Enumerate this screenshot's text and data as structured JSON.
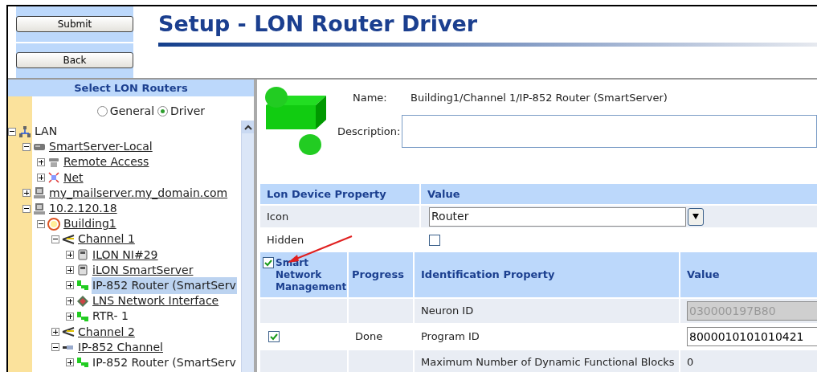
{
  "buttons": [
    {
      "label": "Submit"
    },
    {
      "label": "Back"
    }
  ],
  "page_title": "Setup - LON Router Driver",
  "sidebar": {
    "title": "Select LON Routers",
    "view_options": [
      {
        "label": "General",
        "selected": false
      },
      {
        "label": "Driver",
        "selected": true
      }
    ],
    "tree": [
      {
        "label": "LAN",
        "kind": "network",
        "link": false,
        "expanded": true,
        "selected": false,
        "children": [
          {
            "label": "SmartServer-Local",
            "kind": "server",
            "link": true,
            "expanded": true,
            "selected": false,
            "children": [
              {
                "label": "Remote Access",
                "kind": "phone",
                "link": true,
                "expanded": false,
                "selected": false
              },
              {
                "label": "Net",
                "kind": "net",
                "link": true,
                "expanded": false,
                "selected": false
              }
            ]
          },
          {
            "label": "my_mailserver.my_domain.com",
            "kind": "computer",
            "link": true,
            "expanded": false,
            "selected": false
          },
          {
            "label": "10.2.120.18",
            "kind": "computer",
            "link": true,
            "expanded": true,
            "selected": false,
            "children": [
              {
                "label": "Building1",
                "kind": "building",
                "link": true,
                "expanded": true,
                "selected": false,
                "children": [
                  {
                    "label": "Channel 1",
                    "kind": "channel",
                    "link": true,
                    "expanded": true,
                    "selected": false,
                    "children": [
                      {
                        "label": "ILON NI#29",
                        "kind": "device",
                        "link": true,
                        "expanded": false,
                        "selected": false
                      },
                      {
                        "label": "iLON SmartServer",
                        "kind": "device",
                        "link": true,
                        "expanded": false,
                        "selected": false
                      },
                      {
                        "label": "IP-852 Router (SmartServ",
                        "kind": "router",
                        "link": false,
                        "expanded": false,
                        "selected": true
                      },
                      {
                        "label": "LNS Network Interface",
                        "kind": "interface",
                        "link": true,
                        "expanded": false,
                        "selected": false
                      },
                      {
                        "label": "RTR- 1",
                        "kind": "router",
                        "link": false,
                        "expanded": false,
                        "selected": false
                      }
                    ]
                  },
                  {
                    "label": "Channel 2",
                    "kind": "channel",
                    "link": true,
                    "expanded": false,
                    "selected": false
                  },
                  {
                    "label": "IP-852 Channel",
                    "kind": "plug",
                    "link": true,
                    "expanded": true,
                    "selected": false,
                    "children": [
                      {
                        "label": "IP-852 Router (SmartServ",
                        "kind": "router",
                        "link": false,
                        "expanded": false,
                        "selected": false
                      }
                    ]
                  }
                ]
              }
            ]
          }
        ]
      }
    ]
  },
  "device": {
    "name_label": "Name:",
    "name": "Building1/Channel 1/IP-852 Router (SmartServer)",
    "description_label": "Description:"
  },
  "lon_table": {
    "columns": [
      "Lon Device Property",
      "Value"
    ],
    "rows": [
      {
        "property": "Icon",
        "kind": "dropdown",
        "value": "Router"
      },
      {
        "property": "Hidden",
        "kind": "checkbox",
        "checked": false
      }
    ]
  },
  "id_table": {
    "smart_checked": true,
    "columns": [
      "Smart Network Management",
      "Progress",
      "Identification Property",
      "Value"
    ],
    "rows": [
      {
        "smart": false,
        "property": "Neuron ID",
        "kind": "disabled_input",
        "value": "030000197B80"
      },
      {
        "smart": true,
        "progress": "Done",
        "property": "Program ID",
        "kind": "input",
        "value": "8000010101010421"
      },
      {
        "smart": false,
        "property": "Maximum Number of Dynamic Functional Blocks",
        "kind": "text",
        "value": "0"
      }
    ]
  }
}
